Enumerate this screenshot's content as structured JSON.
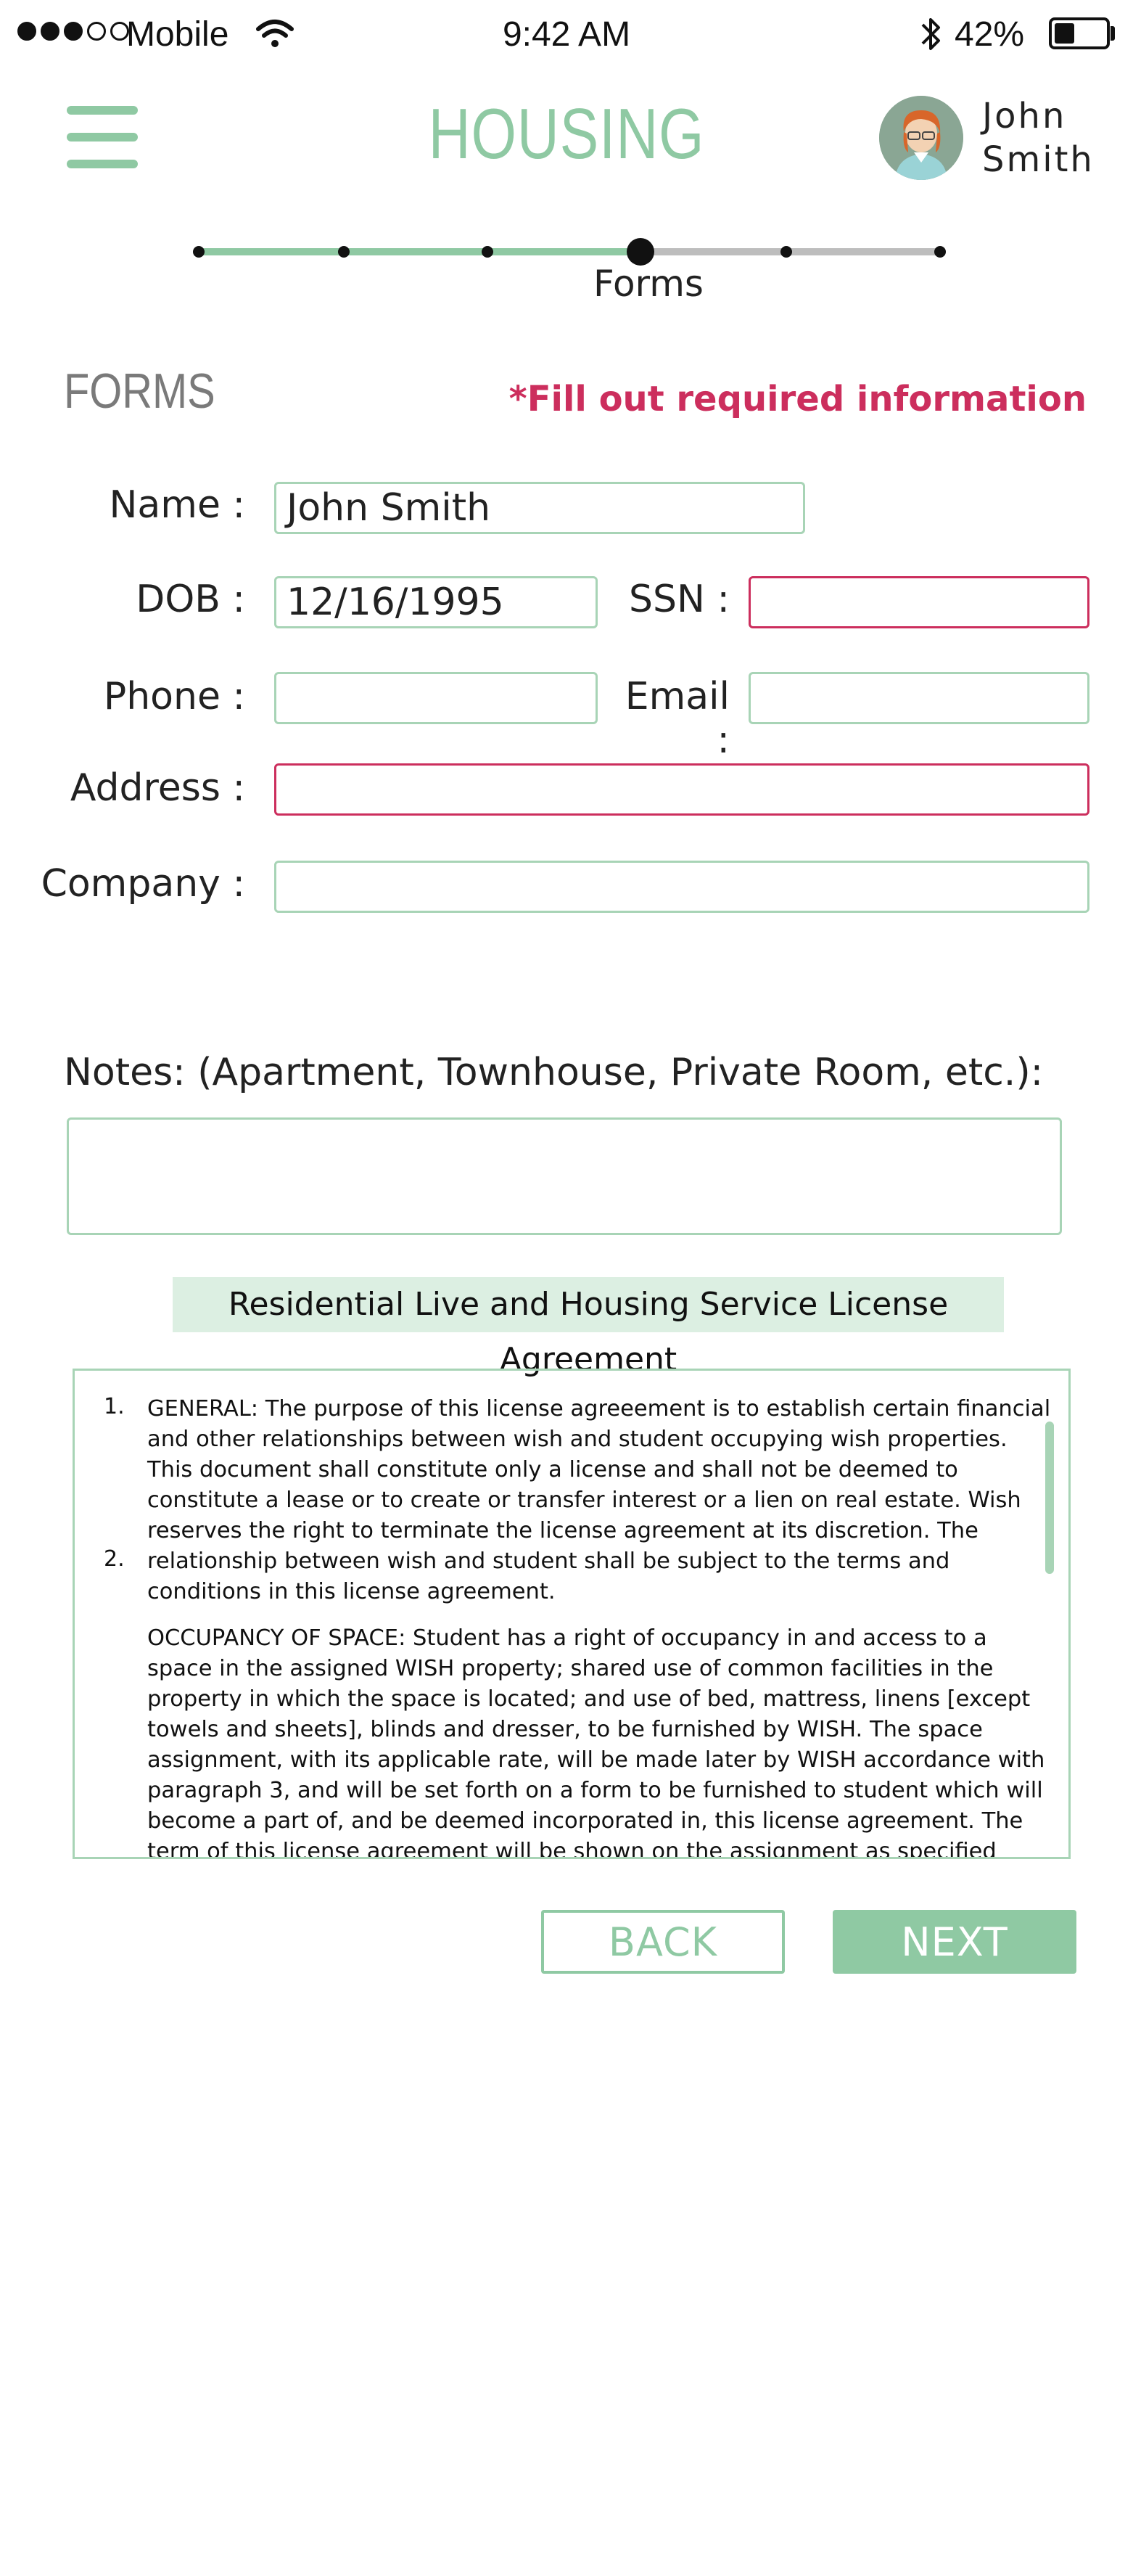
{
  "status_bar": {
    "carrier": "Mobile",
    "time": "9:42 AM",
    "battery": "42%",
    "signal_icon": "signal-dots-icon",
    "wifi_icon": "wifi-icon",
    "bluetooth_icon": "bluetooth-icon"
  },
  "header": {
    "title": "HOUSING",
    "user_first": "John",
    "user_last": "Smith",
    "menu_icon": "hamburger-menu-icon"
  },
  "progress": {
    "steps_total": 6,
    "current_step": 4,
    "current_label": "Forms"
  },
  "form": {
    "section_title": "FORMS",
    "required_note": "*Fill out required information",
    "name_label": "Name :",
    "name_value": "John Smith",
    "dob_label": "DOB :",
    "dob_value": "12/16/1995",
    "ssn_label": "SSN :",
    "ssn_value": "",
    "phone_label": "Phone :",
    "phone_value": "",
    "email_label": "Email :",
    "email_value": "",
    "address_label": "Address :",
    "address_value": "",
    "company_label": "Company :",
    "company_value": ""
  },
  "notes": {
    "label": "Notes: (Apartment, Townhouse, Private Room, etc.):",
    "value": ""
  },
  "license": {
    "title": "Residential Live and Housing Service License Agreement",
    "items": [
      {
        "num": "1.",
        "text": "GENERAL: The purpose of this license agreeement is to establish certain financial and other relationships between wish and student occupying wish properties. This document shall constitute only a license and shall not be deemed to constitute a lease or to create or transfer interest or a lien on real estate. Wish reserves the right to terminate the license agreement at its discretion. The relationship between wish and student shall be subject to the terms and conditions in this license agreement."
      },
      {
        "num": "2.",
        "text": "OCCUPANCY OF SPACE: Student has a right of occupancy in and access to a space in the assigned WISH property; shared use of common facilities in the property in which the space is located; and use of bed, mattress, linens [except towels and sheets], blinds and dresser, to be furnished by WISH. The space assignment, with its applicable rate, will be made later by WISH accordance with paragraph 3, and will be set forth on a form to be furnished to student which will become a part of, and be deemed incorporated in, this license agreement.  The term of this license agreement will be shown on the assignment as specified above.  The term will be the period of time covered by the summer and fall and/or spring semesters, subject to other"
      }
    ]
  },
  "buttons": {
    "back": "BACK",
    "next": "NEXT"
  },
  "colors": {
    "accent": "#8fc9a3",
    "error": "#cc2e5d",
    "field_border": "#a8d4b6",
    "license_title_bg": "#dcefe2"
  }
}
